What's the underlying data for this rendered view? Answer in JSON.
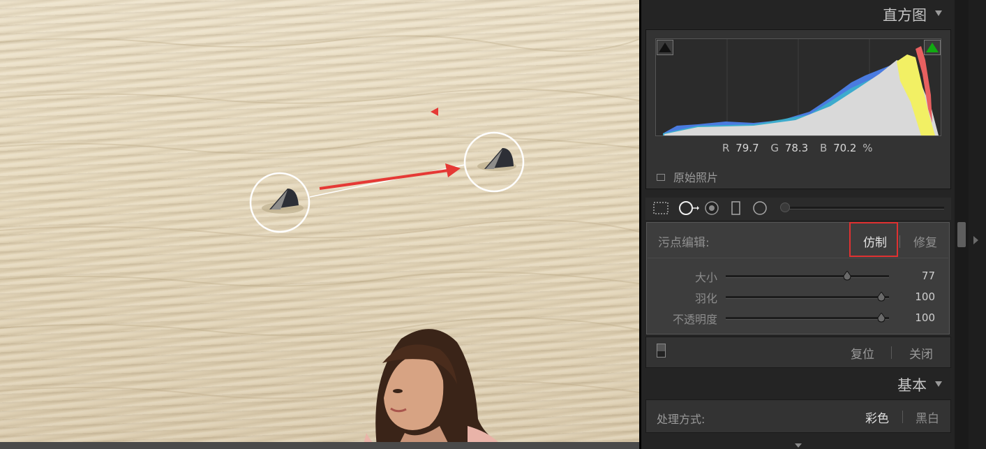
{
  "histogram": {
    "title": "直方图",
    "r_label": "R",
    "r_value": "79.7",
    "g_label": "G",
    "g_value": "78.3",
    "b_label": "B",
    "b_value": "70.2",
    "percent": "%",
    "original_photo_label": "原始照片"
  },
  "tools": [
    "crop-overlay",
    "spot-removal",
    "red-eye",
    "graduated-filter",
    "radial-filter",
    "adjustment-brush"
  ],
  "spot_edit": {
    "label": "污点编辑:",
    "mode_clone": "仿制",
    "mode_heal": "修复",
    "active_mode": "仿制",
    "sliders": [
      {
        "label": "大小",
        "value": "77",
        "level": 0.77
      },
      {
        "label": "羽化",
        "value": "100",
        "level": 1.0
      },
      {
        "label": "不透明度",
        "value": "100",
        "level": 1.0
      }
    ],
    "reset_label": "复位",
    "close_label": "关闭"
  },
  "basic": {
    "title": "基本",
    "treatment_label": "处理方式:",
    "color_label": "彩色",
    "bw_label": "黑白"
  },
  "colors": {
    "highlight_box": "#e03131",
    "arrow": "#e53935",
    "clip_shadow": "#111111",
    "clip_highlight": "#11aa11"
  }
}
